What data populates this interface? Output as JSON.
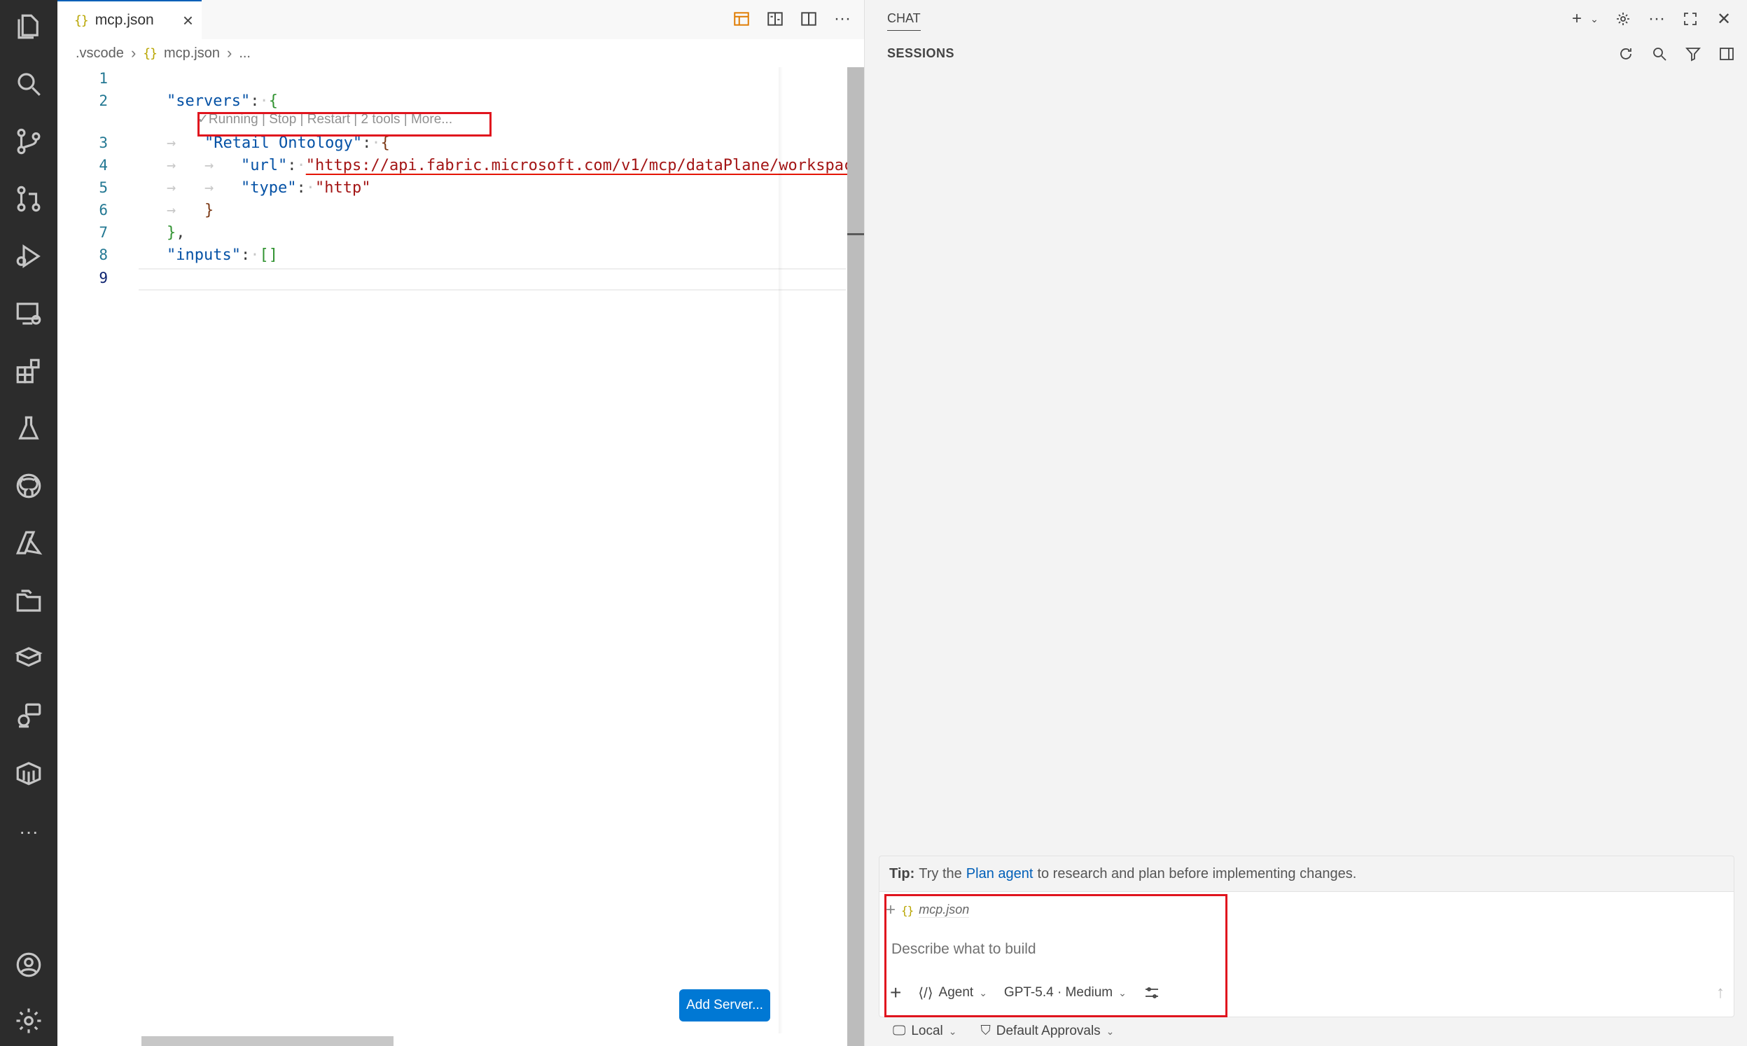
{
  "editor": {
    "tab": {
      "icon": "{}",
      "label": "mcp.json"
    },
    "breadcrumb": {
      "folder": ".vscode",
      "file": "mcp.json",
      "more": "..."
    },
    "line_numbers": [
      "1",
      "2",
      "3",
      "4",
      "5",
      "6",
      "7",
      "8",
      "9"
    ],
    "code": {
      "servers_key": "\"servers\"",
      "retail_key": "\"Retail Ontology\"",
      "url_key": "\"url\"",
      "url_value": "\"https://api.fabric.microsoft.com/v1/mcp/dataPlane/workspac",
      "type_key": "\"type\"",
      "type_value": "\"http\"",
      "inputs_key": "\"inputs\""
    },
    "codelens": "✓Running | Stop | Restart | 2 tools | More...",
    "add_server_label": "Add Server..."
  },
  "chat": {
    "title": "CHAT",
    "sessions_label": "SESSIONS",
    "tip": {
      "prefix": "Tip:",
      "text_before": "Try the",
      "link": "Plan agent",
      "text_after": "to research and plan before implementing changes."
    },
    "attachment": {
      "icon": "{}",
      "name": "mcp.json"
    },
    "input_placeholder": "Describe what to build",
    "mode": "Agent",
    "model": "GPT-5.4 · Medium",
    "footer": {
      "location": "Local",
      "approvals": "Default Approvals"
    }
  },
  "colors": {
    "accent": "#0078d4",
    "highlight_box": "#e0141e",
    "activity_bar": "#2c2c2c"
  }
}
